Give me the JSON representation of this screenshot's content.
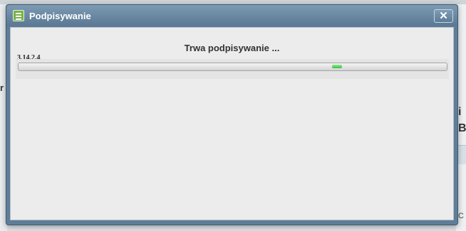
{
  "dialog": {
    "title": "Podpisywanie",
    "close_label": "✕",
    "status_text": "Trwa podpisywanie ...",
    "version": "3.14.2.4",
    "progress_fraction": 0.75,
    "icon": "signing-document-icon"
  },
  "background": {
    "fragment_left": "r",
    "fragment_right_1": "i",
    "fragment_right_2": "B",
    "fragment_right_3": "C"
  },
  "colors": {
    "titlebar": "#5a7893",
    "icon_green": "#7bb24b",
    "progress_green": "#2fc33a"
  }
}
